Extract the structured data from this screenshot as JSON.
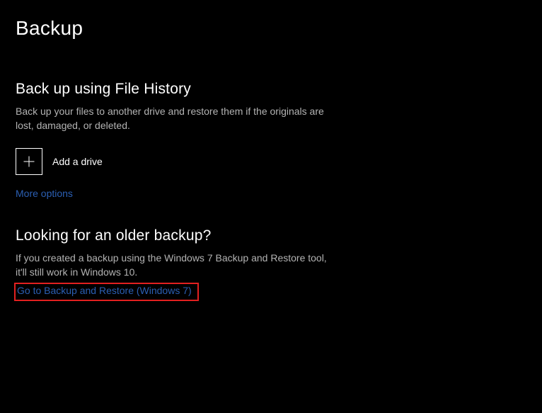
{
  "page": {
    "title": "Backup"
  },
  "fileHistory": {
    "heading": "Back up using File History",
    "description": "Back up your files to another drive and restore them if the originals are lost, damaged, or deleted.",
    "addDriveLabel": "Add a drive",
    "moreOptionsLabel": "More options"
  },
  "olderBackup": {
    "heading": "Looking for an older backup?",
    "description": "If you created a backup using the Windows 7 Backup and Restore tool, it'll still work in Windows 10.",
    "linkLabel": "Go to Backup and Restore (Windows 7)"
  },
  "colors": {
    "link": "#2b5fb3",
    "highlight": "#e22020"
  }
}
